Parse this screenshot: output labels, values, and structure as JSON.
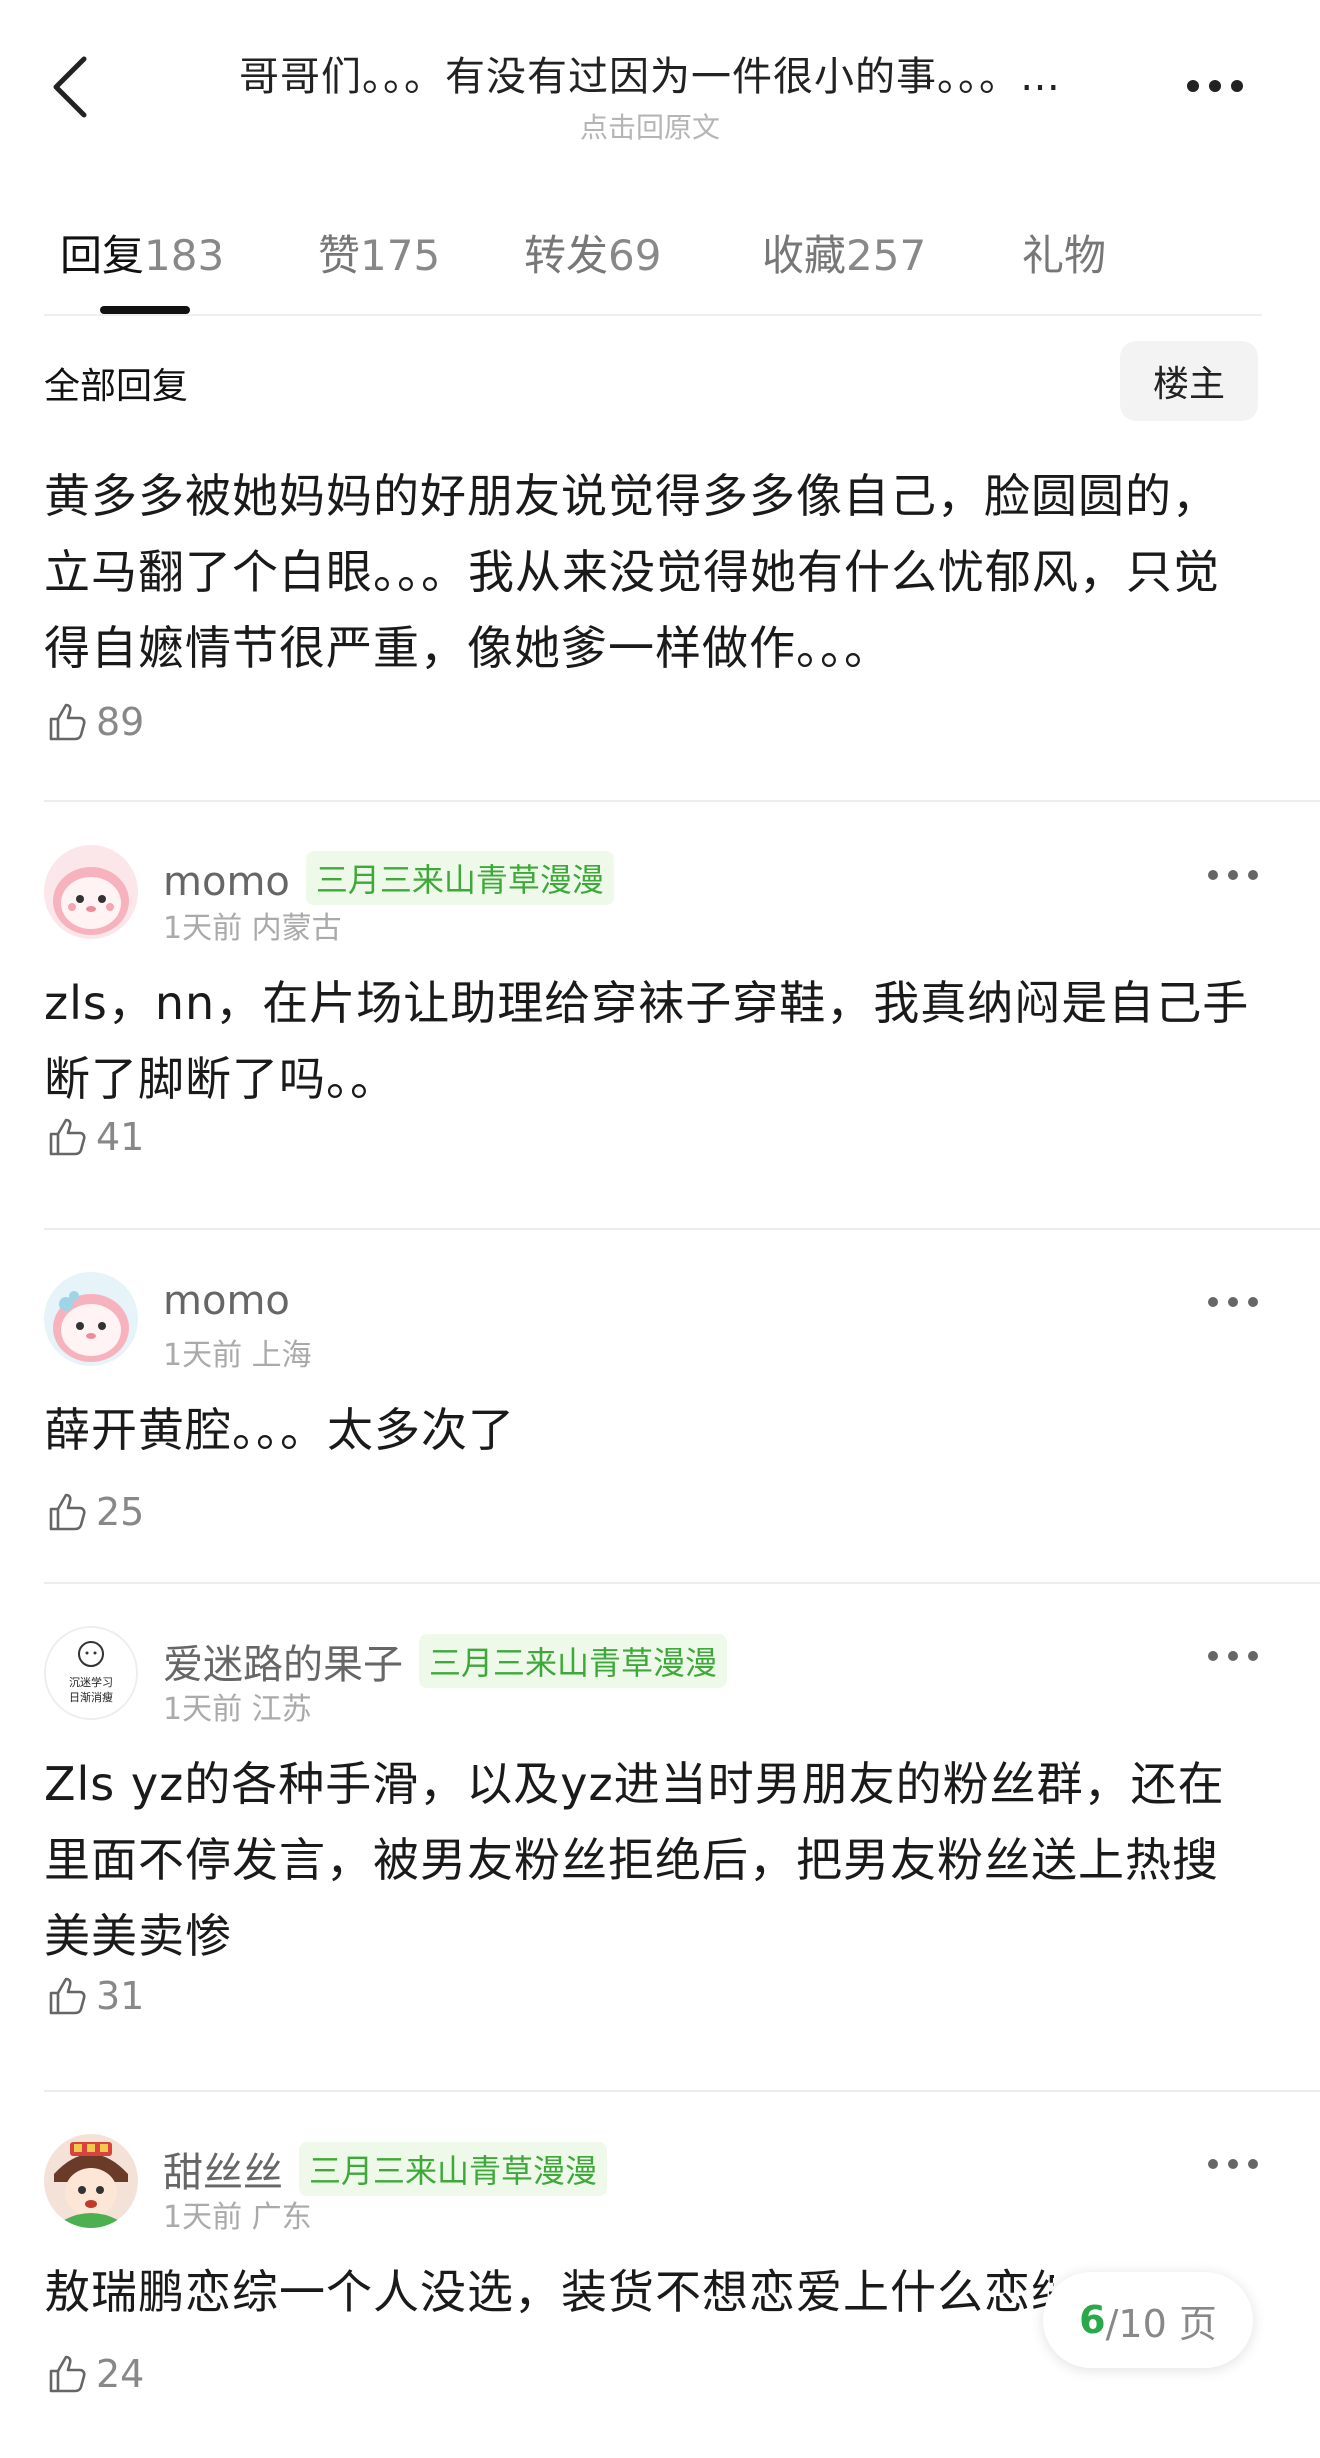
{
  "header": {
    "title": "哥哥们。。。有没有过因为一件很小的事。。。…",
    "subtitle": "点击回原文",
    "back_icon": "chevron-left-icon",
    "more_icon": "more-horizontal-icon"
  },
  "tabs": [
    {
      "label": "回复",
      "count": "183"
    },
    {
      "label": "赞",
      "count": "175"
    },
    {
      "label": "转发",
      "count": "69"
    },
    {
      "label": "收藏",
      "count": "257"
    },
    {
      "label": "礼物",
      "count": ""
    }
  ],
  "filter": {
    "all_label": "全部回复",
    "op_label": "楼主"
  },
  "posts": [
    {
      "text": "黄多多被她妈妈的好朋友说觉得多多像自己，脸圆圆的，立马翻了个白眼。。。我从来没觉得她有什么忧郁风，只觉得自嬷情节很严重，像她爹一样做作。。。",
      "likes": "89"
    },
    {
      "name": "momo",
      "badge": "三月三来山青草漫漫",
      "time": "1天前",
      "location": "内蒙古",
      "text": "zls，nn，在片场让助理给穿袜子穿鞋，我真纳闷是自己手断了脚断了吗。。",
      "likes": "41"
    },
    {
      "name": "momo",
      "badge": "",
      "time": "1天前",
      "location": "上海",
      "text": "薛开黄腔。。。太多次了",
      "likes": "25"
    },
    {
      "name": "爱迷路的果子",
      "badge": "三月三来山青草漫漫",
      "time": "1天前",
      "location": "江苏",
      "text": "Zls yz的各种手滑，以及yz进当时男朋友的粉丝群，还在里面不停发言，被男友粉丝拒绝后，把男友粉丝送上热搜美美卖惨",
      "likes": "31",
      "avatar_text": [
        "沉迷学习",
        "日渐消瘦"
      ]
    },
    {
      "name": "甜丝丝",
      "badge": "三月三来山青草漫漫",
      "time": "1天前",
      "location": "广东",
      "text": "敖瑞鹏恋综一个人没选，装货不想恋爱上什么恋综",
      "likes": "24"
    }
  ],
  "pager": {
    "current": "6",
    "total_label": "/10 页"
  },
  "colors": {
    "badge_bg": "#eef9ea",
    "badge_text": "#3ea93a",
    "pager_current": "#2aa84a"
  }
}
